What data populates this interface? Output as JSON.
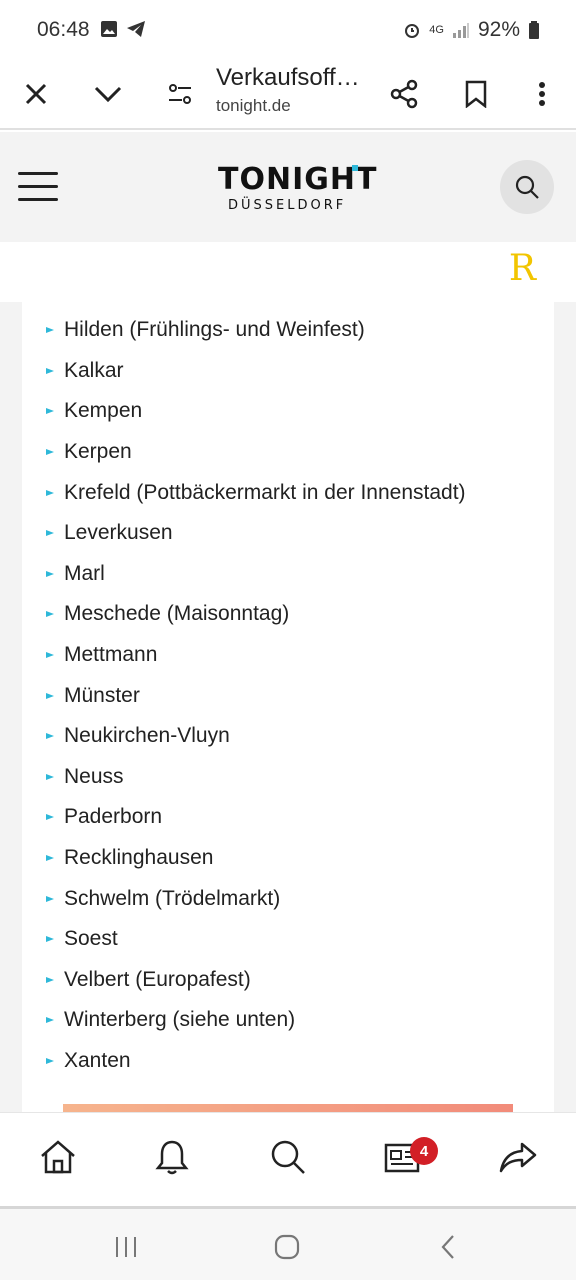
{
  "status": {
    "time": "06:48",
    "battery": "92%",
    "network": "4G"
  },
  "browser": {
    "title": "Verkaufsoff…",
    "url": "tonight.de"
  },
  "site": {
    "logo_main": "TONIGHT",
    "logo_sub": "DÜSSELDORF",
    "ad_mark": "R"
  },
  "content": {
    "cities": [
      "Hilden (Frühlings- und Weinfest)",
      "Kalkar",
      "Kempen",
      "Kerpen",
      "Krefeld (Pottbäckermarkt in der Innenstadt)",
      "Leverkusen",
      "Marl",
      "Meschede (Maisonntag)",
      "Mettmann",
      "Münster",
      "Neukirchen-Vluyn",
      "Neuss",
      "Paderborn",
      "Recklinghausen",
      "Schwelm (Trödelmarkt)",
      "Soest",
      "Velbert (Europafest)",
      "Winterberg (siehe unten)",
      "Xanten"
    ]
  },
  "bottom_nav": {
    "badge_count": "4"
  },
  "icons": {
    "close": "close-icon",
    "dropdown": "chevron-down-icon",
    "settings": "tune-icon",
    "share": "share-icon",
    "bookmark": "bookmark-icon",
    "more": "more-vert-icon",
    "home": "home-icon",
    "alerts": "bell-icon",
    "search": "search-icon",
    "news": "newspaper-icon",
    "forward": "forward-icon"
  },
  "colors": {
    "accent": "#2eb8d9",
    "badge": "#d21f26",
    "ad_mark": "#f2c500"
  }
}
